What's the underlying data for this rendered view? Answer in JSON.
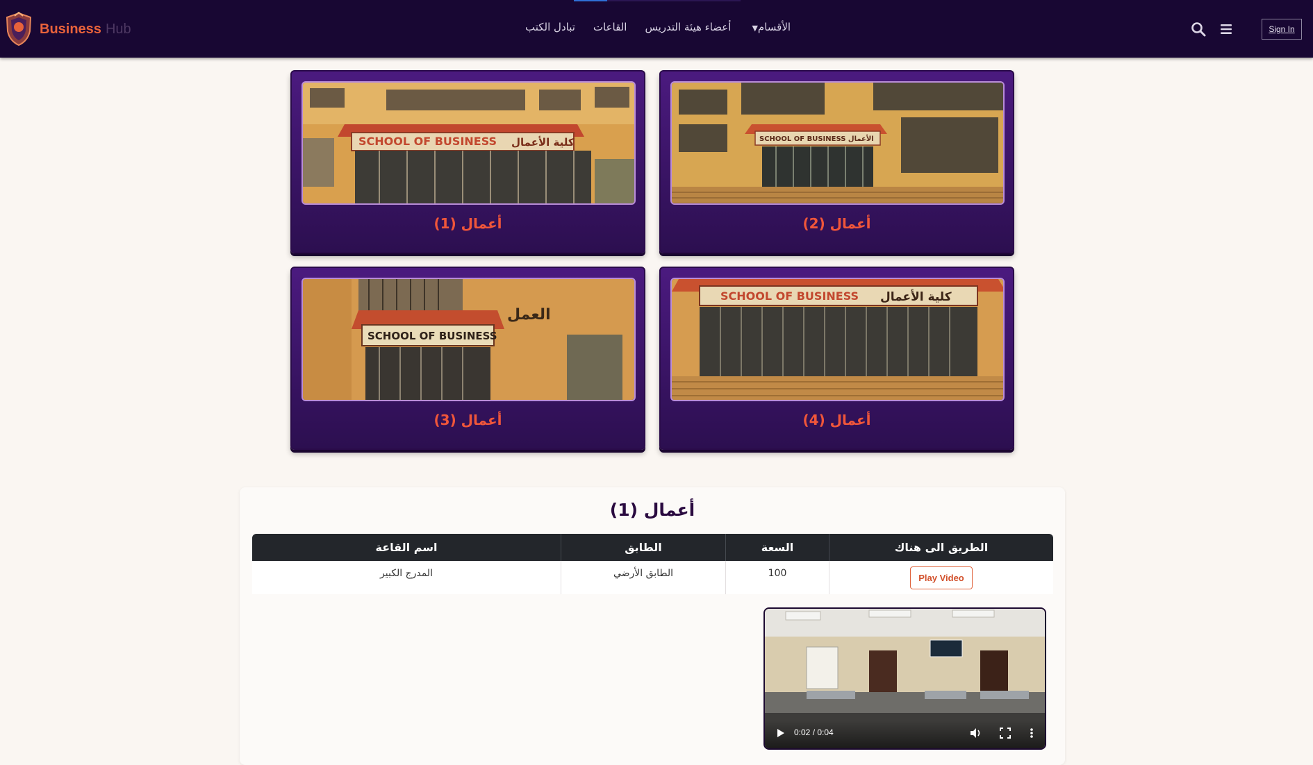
{
  "header": {
    "brand_name": "Business",
    "brand_sub": "Hub",
    "nav": [
      {
        "label": "تبادل الكتب"
      },
      {
        "label": "القاعات"
      },
      {
        "label": "أعضاء هيئة التدريس"
      },
      {
        "label": "الأقسام"
      }
    ],
    "sign_in": "Sign In",
    "icons": [
      "search-icon",
      "menu-icon"
    ]
  },
  "cards": [
    {
      "title": "أعمال (1)",
      "sign_en": "SCHOOL OF BUSINESS",
      "sign_ar": "كلية الأعمال"
    },
    {
      "title": "أعمال (2)",
      "sign_en": "SCHOOL OF BUSINESS",
      "sign_ar": "الأعمال"
    },
    {
      "title": "أعمال (3)",
      "sign_en": "SCHOOL OF BUSINESS",
      "sign_ar": "العمل"
    },
    {
      "title": "أعمال (4)",
      "sign_en": "SCHOOL OF BUSINESS",
      "sign_ar": "كلية الأعمال"
    }
  ],
  "details": {
    "title": "أعمال (1)",
    "columns": [
      "اسم القاعة",
      "الطابق",
      "السعة",
      "الطريق الى هناك"
    ],
    "row": {
      "name": "المدرج الكبير",
      "floor": "الطابق الأرضي",
      "capacity": "100",
      "action": "Play Video"
    }
  },
  "video": {
    "time": "0:02 / 0:04",
    "progress": 0.5
  },
  "colors": {
    "nav_bg": "#180733",
    "card_bg": "#4b1a7f",
    "accent": "#f0563a",
    "table_header": "#23262b"
  }
}
